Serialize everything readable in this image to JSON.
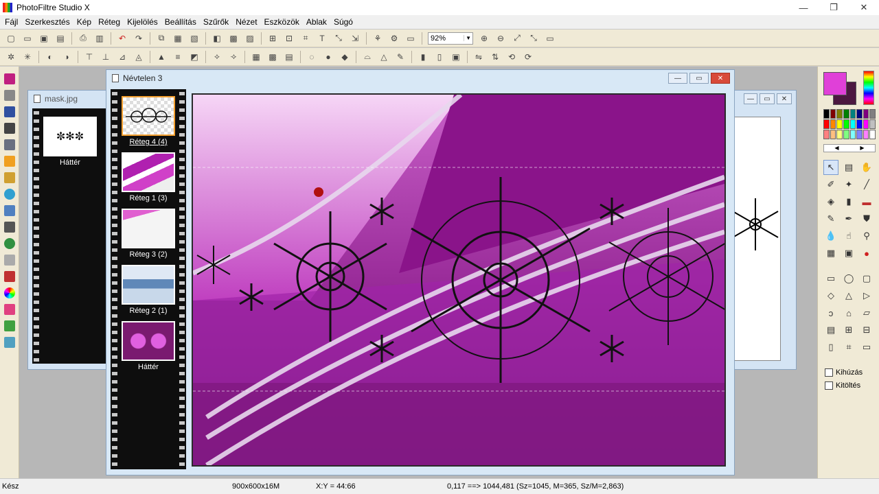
{
  "app": {
    "title": "PhotoFiltre Studio X"
  },
  "window_controls": {
    "minimize": "—",
    "restore": "❐",
    "close": "✕"
  },
  "menu": [
    "Fájl",
    "Szerkesztés",
    "Kép",
    "Réteg",
    "Kijelölés",
    "Beállítás",
    "Szűrők",
    "Nézet",
    "Eszközök",
    "Ablak",
    "Súgó"
  ],
  "toolbar": {
    "zoom": "92%"
  },
  "documents": {
    "mask": {
      "title": "mask.jpg",
      "layers": [
        {
          "name": "Háttér"
        }
      ]
    },
    "main": {
      "title": "Névtelen 3",
      "layers": [
        {
          "name": "Réteg 4 (4)",
          "selected": true
        },
        {
          "name": "Réteg 1 (3)",
          "selected": false
        },
        {
          "name": "Réteg 3 (2)",
          "selected": false
        },
        {
          "name": "Réteg 2 (1)",
          "selected": false
        },
        {
          "name": "Háttér",
          "selected": false
        }
      ]
    }
  },
  "colors": {
    "foreground": "#e040d8",
    "background": "#4c1840",
    "accent": "#f4a030"
  },
  "options": {
    "kihuzas": "Kihúzás",
    "kitoltes": "Kitöltés"
  },
  "status": {
    "state": "Kész",
    "size": "900x600x16M",
    "coords": "X:Y = 44:66",
    "selection": "0,117 ==> 1044,481 (Sz=1045, M=365, Sz/M=2,863)"
  }
}
